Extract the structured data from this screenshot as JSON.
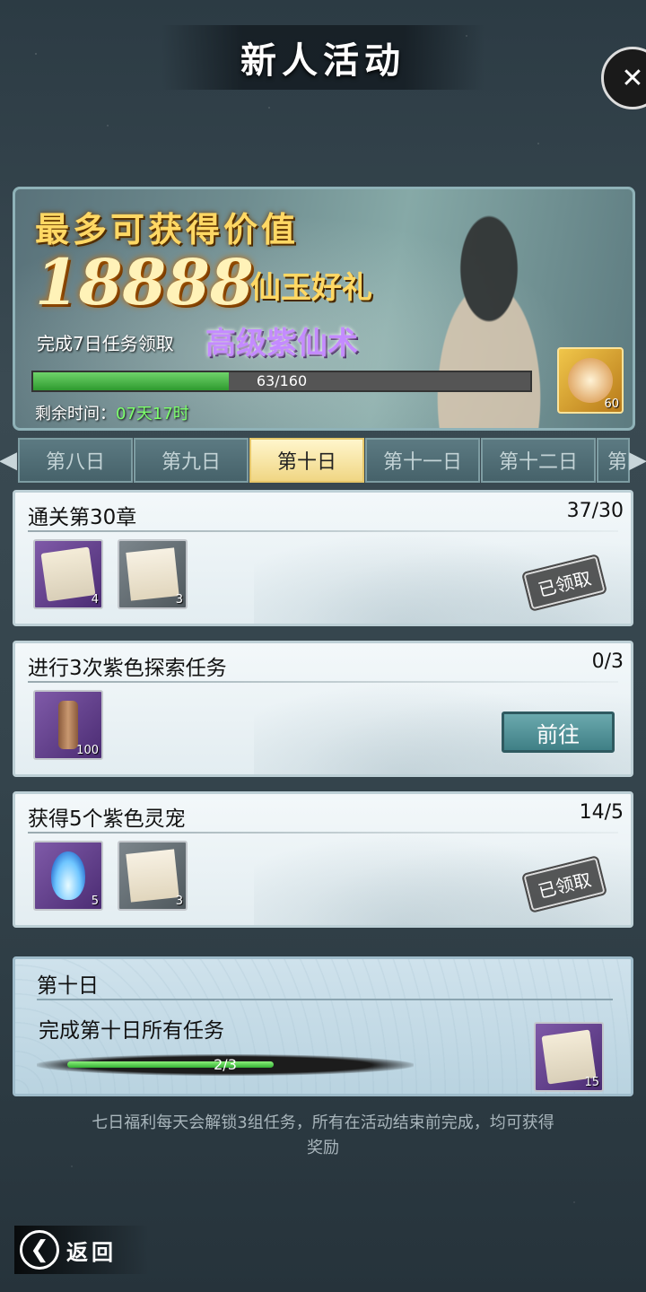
{
  "header": {
    "title": "新人活动",
    "close_icon": "close-icon"
  },
  "banner": {
    "headline": "最多可获得价值",
    "big_number": "18888",
    "big_suffix": "仙玉好礼",
    "complete_text": "完成7日任务领取",
    "reward_name": "高级紫仙术",
    "progress": {
      "current": 63,
      "total": 160,
      "text": "63/160",
      "fraction": 0.394
    },
    "remain_label": "剩余时间：",
    "remain_value": "07天17时",
    "item_count": "60"
  },
  "tabs": [
    {
      "label": "第八日",
      "active": false
    },
    {
      "label": "第九日",
      "active": false
    },
    {
      "label": "第十日",
      "active": true
    },
    {
      "label": "第十一日",
      "active": false
    },
    {
      "label": "第十二日",
      "active": false
    },
    {
      "label": "第",
      "active": false
    }
  ],
  "tasks": [
    {
      "title": "通关第30章",
      "progress": "37/30",
      "rewards": [
        {
          "icon": "scroll-icon",
          "count": "4"
        },
        {
          "icon": "paper-icon",
          "count": "3"
        }
      ],
      "status": "已领取"
    },
    {
      "title": "进行3次紫色探索任务",
      "progress": "0/3",
      "rewards": [
        {
          "icon": "roll-icon",
          "count": "100"
        }
      ],
      "button": "前往"
    },
    {
      "title": "获得5个紫色灵宠",
      "progress": "14/5",
      "rewards": [
        {
          "icon": "flame-icon",
          "count": "5"
        },
        {
          "icon": "paper-icon",
          "count": "3"
        }
      ],
      "status": "已领取"
    }
  ],
  "summary": {
    "day": "第十日",
    "desc": "完成第十日所有任务",
    "progress_text": "2/3",
    "fraction": 0.667,
    "reward_count": "15"
  },
  "footnote": "七日福利每天会解锁3组任务，所有在活动结束前完成，均可获得奖励",
  "back_label": "返回"
}
